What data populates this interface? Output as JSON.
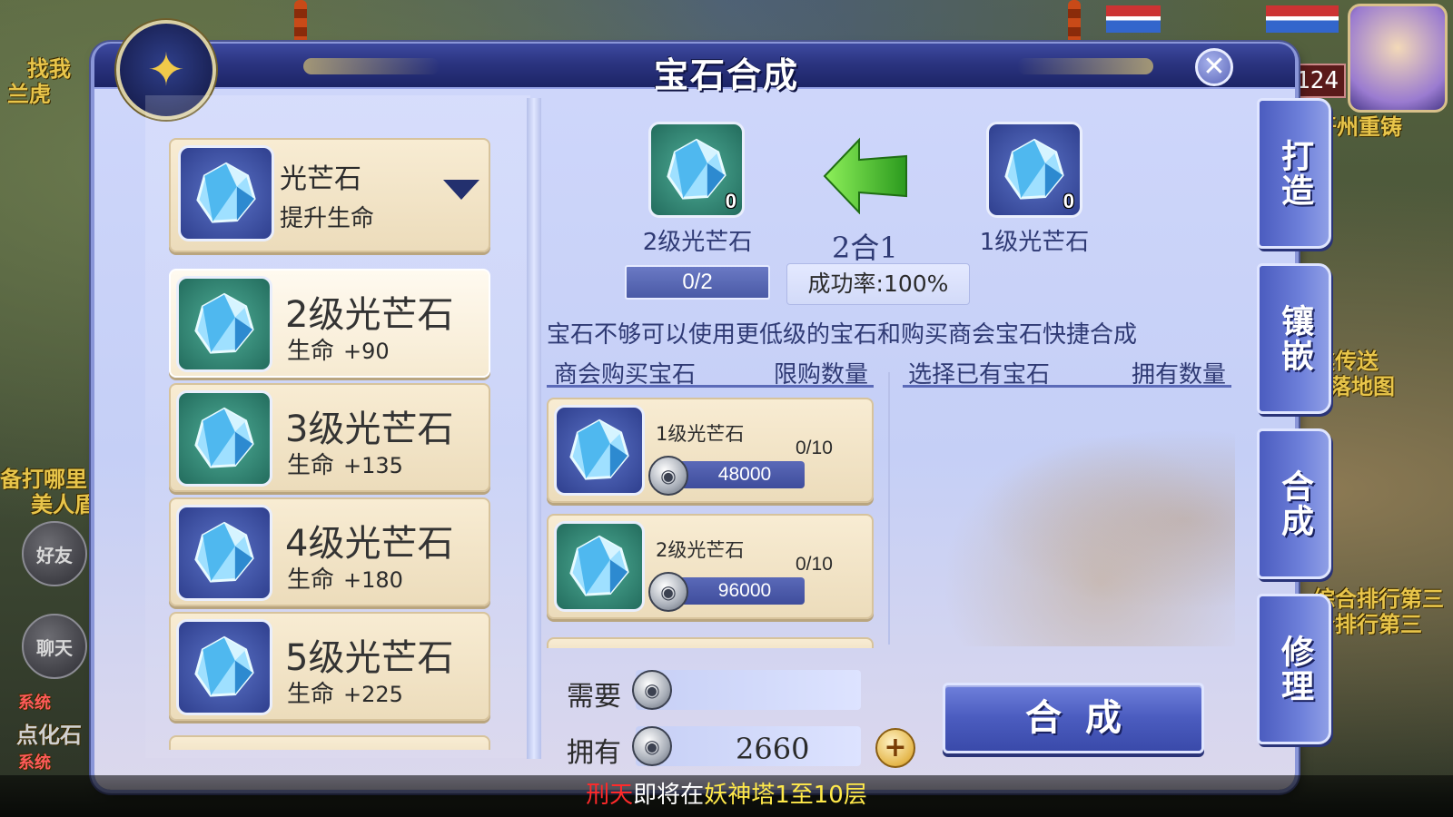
{
  "window": {
    "title": "宝石合成",
    "close_icon": "close-icon",
    "emblem_icon": "gem-chest-icon"
  },
  "type_selector": {
    "name": "光芒石",
    "desc": "提升生命",
    "icon": "blue-gem-icon"
  },
  "gem_list": [
    {
      "name": "2级光芒石",
      "stat": "生命",
      "value": "+90",
      "frame": "green",
      "selected": true
    },
    {
      "name": "3级光芒石",
      "stat": "生命",
      "value": "+135",
      "frame": "green",
      "selected": false
    },
    {
      "name": "4级光芒石",
      "stat": "生命",
      "value": "+180",
      "frame": "blue",
      "selected": false
    },
    {
      "name": "5级光芒石",
      "stat": "生命",
      "value": "+225",
      "frame": "blue",
      "selected": false
    }
  ],
  "synth": {
    "target": {
      "name": "2级光芒石",
      "count": "0"
    },
    "source": {
      "name": "1级光芒石",
      "count": "0"
    },
    "ratio": "2合1",
    "progress": "0/2",
    "success_rate": "成功率:100%",
    "hint": "宝石不够可以使用更低级的宝石和购买商会宝石快捷合成"
  },
  "shop_headers": {
    "buy": "商会购买宝石",
    "limit": "限购数量",
    "owned": "选择已有宝石",
    "count": "拥有数量"
  },
  "shop_items": [
    {
      "name": "1级光芒石",
      "limit": "0/10",
      "price": "48000",
      "frame": "blue"
    },
    {
      "name": "2级光芒石",
      "limit": "0/10",
      "price": "96000",
      "frame": "green"
    }
  ],
  "cost": {
    "need_label": "需要",
    "need_value": "",
    "have_label": "拥有",
    "have_value": "2660"
  },
  "buttons": {
    "synthesize": "合成"
  },
  "tabs": [
    "打造",
    "镶嵌",
    "合成",
    "修理"
  ],
  "world": {
    "top_left_text": "找我",
    "name_left": "兰虎",
    "left_mid_1": "备打哪里",
    "left_mid_2": "美人盾",
    "friend_btn": "好友",
    "chat_btn": "聊天",
    "sys_1": "系统",
    "sys_2": "系统",
    "chat_line": "点化石",
    "hud_level": "124",
    "right_top": "开州重铸",
    "right_mid_1": "棋传送",
    "right_mid_2": "卓落地图",
    "right_low_1": "综合排行第三",
    "right_low_2": "合排行第三"
  },
  "marquee": {
    "part1": "刑天",
    "part2": "即将在",
    "part3": "妖神塔1至10层"
  },
  "colors": {
    "panel_bg": "#c5cff6",
    "title_bar": "#2b3480",
    "accent_blue": "#4b5cbf",
    "card_cream": "#f8ecd3"
  }
}
